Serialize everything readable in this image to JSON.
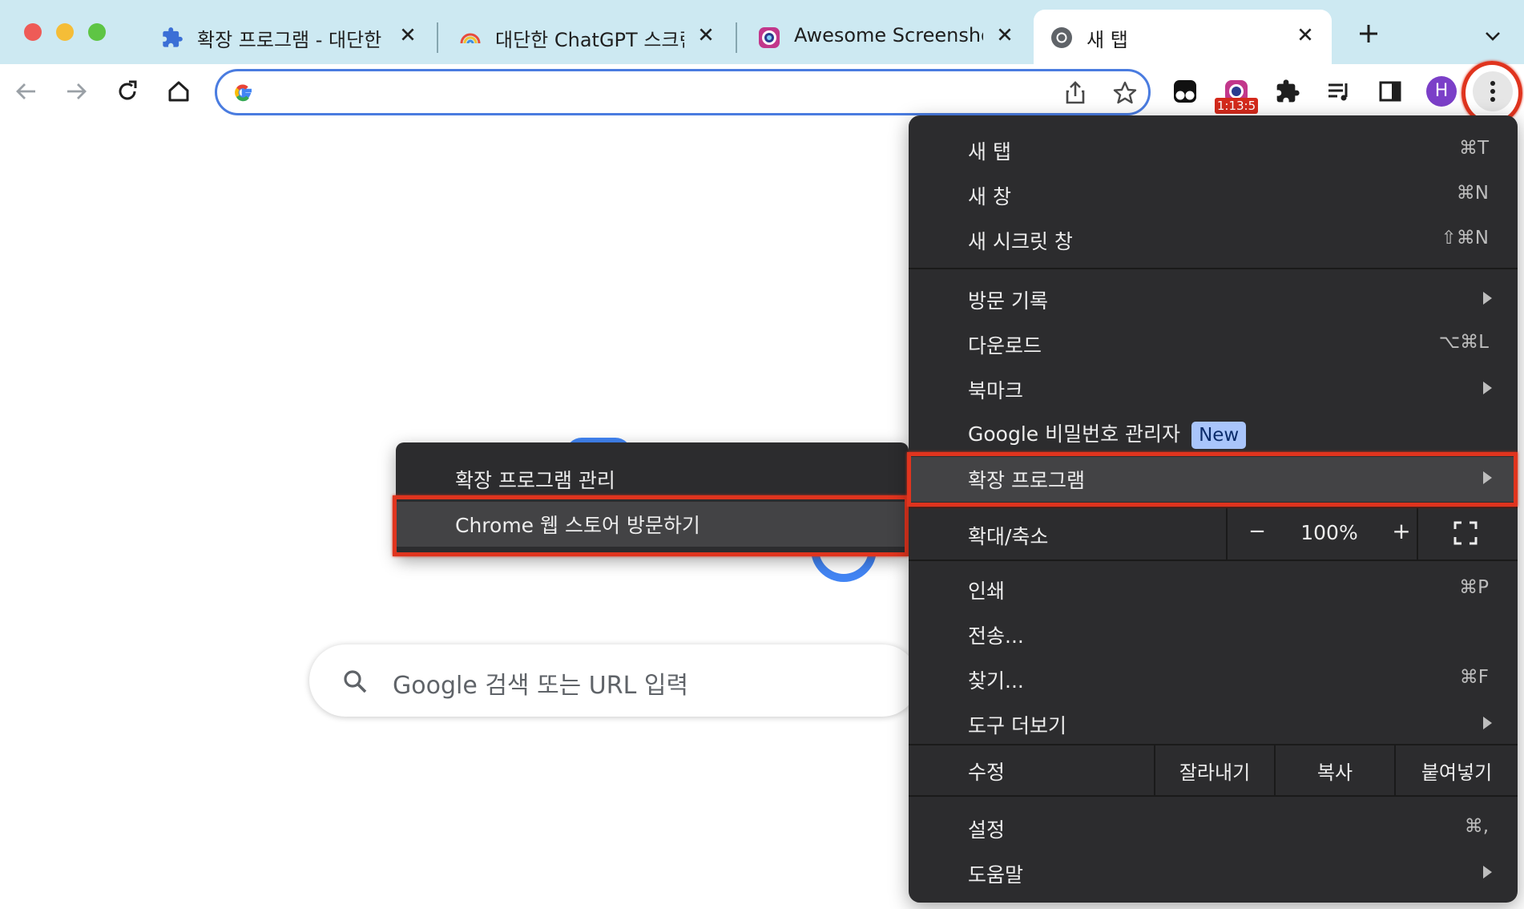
{
  "colors": {
    "tabstrip": "#cde9f2",
    "menu_bg": "#2c2c2e",
    "highlight": "#e0341e",
    "accent": "#4a7ce0"
  },
  "tabs": [
    {
      "title": "확장 프로그램 - 대단한 C",
      "icon": "puzzle-icon"
    },
    {
      "title": "대단한 ChatGPT 스크린",
      "icon": "rainbow-icon"
    },
    {
      "title": "Awesome Screenshot",
      "icon": "awesome-screenshot-icon"
    },
    {
      "title": "새 탭",
      "icon": "chrome-icon"
    }
  ],
  "toolbar": {
    "omnibox_value": "",
    "recorder_badge": "1:13:5",
    "profile_initial": "H"
  },
  "menu": {
    "new_tab": {
      "label": "새 탭",
      "shortcut": "⌘T"
    },
    "new_window": {
      "label": "새 창",
      "shortcut": "⌘N"
    },
    "incognito": {
      "label": "새 시크릿 창",
      "shortcut": "⇧⌘N"
    },
    "history": {
      "label": "방문 기록"
    },
    "downloads": {
      "label": "다운로드",
      "shortcut": "⌥⌘L"
    },
    "bookmarks": {
      "label": "북마크"
    },
    "password_manager": {
      "label": "Google 비밀번호 관리자",
      "badge": "New"
    },
    "extensions": {
      "label": "확장 프로그램"
    },
    "zoom": {
      "label": "확대/축소",
      "minus": "−",
      "value": "100%",
      "plus": "+"
    },
    "print": {
      "label": "인쇄",
      "shortcut": "⌘P"
    },
    "cast": {
      "label": "전송..."
    },
    "find": {
      "label": "찾기...",
      "shortcut": "⌘F"
    },
    "more_tools": {
      "label": "도구 더보기"
    },
    "edit": {
      "label": "수정",
      "cut": "잘라내기",
      "copy": "복사",
      "paste": "붙여넣기"
    },
    "settings": {
      "label": "설정",
      "shortcut": "⌘,"
    },
    "help": {
      "label": "도움말"
    }
  },
  "submenu": {
    "manage": "확장 프로그램 관리",
    "webstore": "Chrome 웹 스토어 방문하기"
  },
  "ntp": {
    "search_placeholder": "Google 검색 또는 URL 입력"
  }
}
